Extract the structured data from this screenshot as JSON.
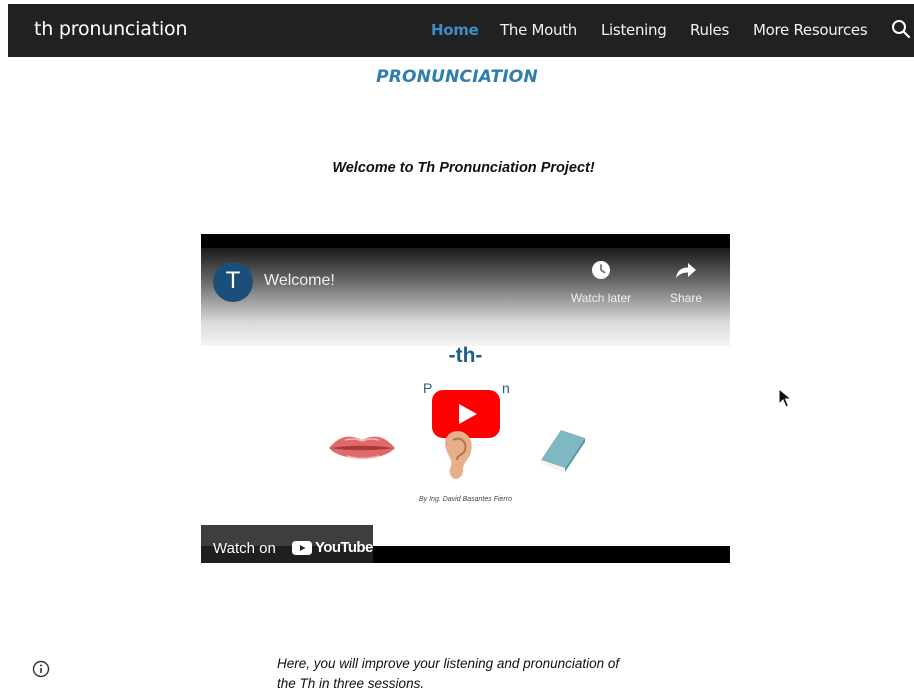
{
  "site": {
    "title": "th pronunciation"
  },
  "nav": {
    "items": [
      {
        "label": "Home",
        "active": true
      },
      {
        "label": "The Mouth",
        "active": false
      },
      {
        "label": "Listening",
        "active": false
      },
      {
        "label": "Rules",
        "active": false
      },
      {
        "label": "More Resources",
        "active": false
      }
    ],
    "search_icon": "search-icon"
  },
  "page": {
    "title": "PRONUNCIATION",
    "welcome": "Welcome to Th Pronunciation Project!"
  },
  "video": {
    "channel_initial": "T",
    "title": "Welcome!",
    "watch_later_label": "Watch later",
    "share_label": "Share",
    "thumbnail": {
      "heading": "-th-",
      "subtitle_left": "P",
      "subtitle_right": "n",
      "author": "By Ing. David Basantes Fierro"
    },
    "watch_on_label": "Watch on",
    "youtube_wordmark": "YouTube"
  },
  "intro": {
    "line1": "Here, you will improve your listening and pronunciation of",
    "line2": "the Th in three sessions."
  },
  "colors": {
    "nav_bg": "#212121",
    "accent": "#3d8ec6",
    "title_blue": "#2e7fae",
    "youtube_red": "#ff0000"
  }
}
